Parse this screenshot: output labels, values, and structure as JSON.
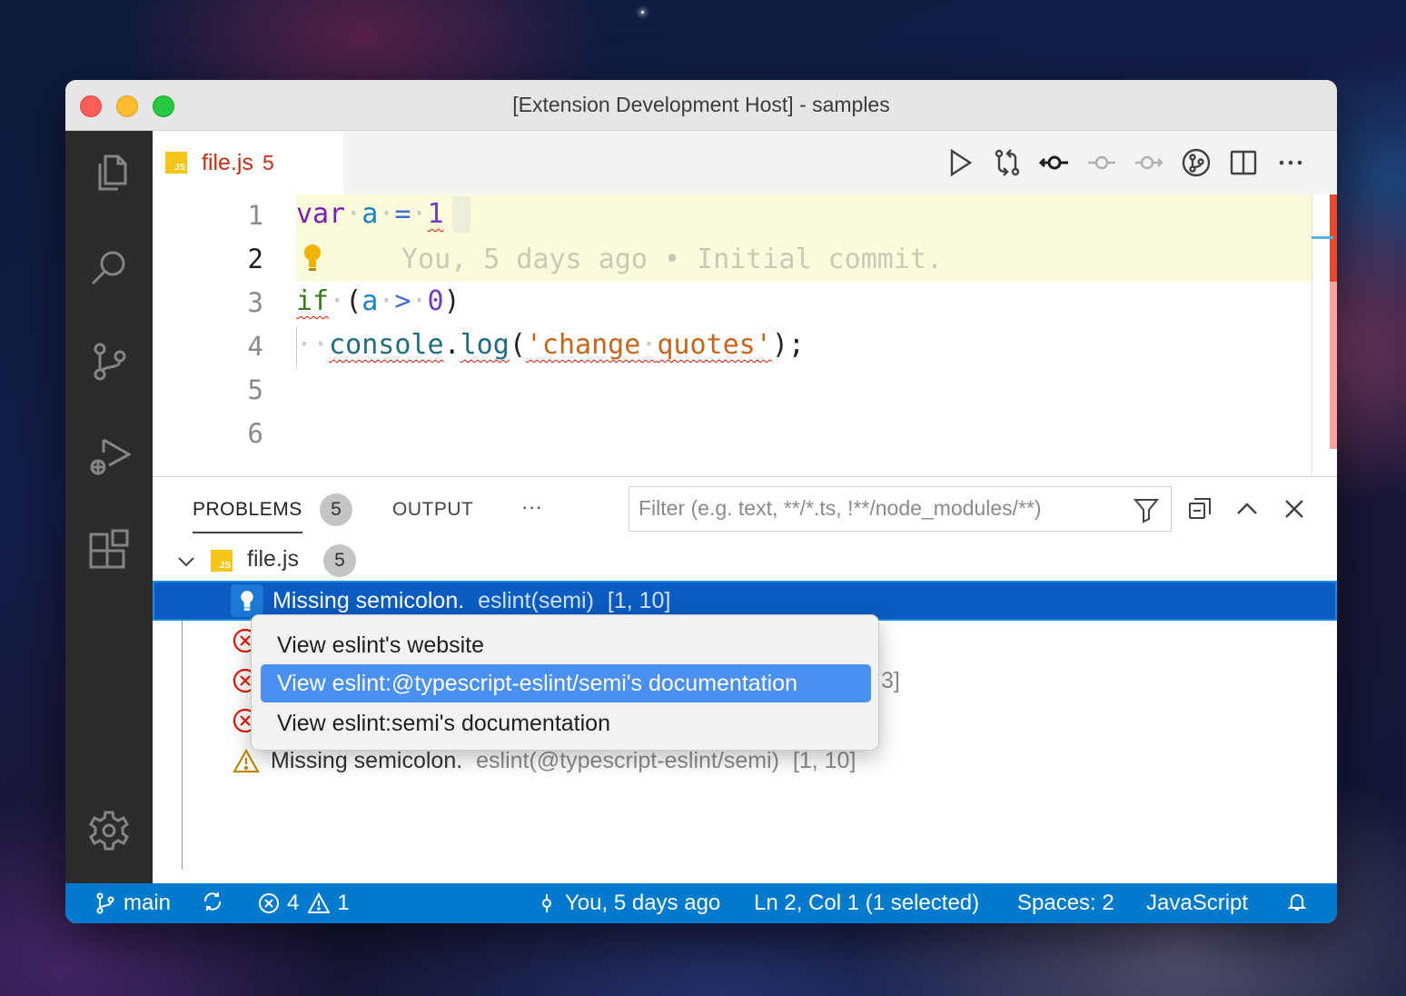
{
  "window": {
    "title": "[Extension Development Host] - samples"
  },
  "activity_bar": {
    "items": [
      {
        "name": "explorer",
        "icon": "files-icon"
      },
      {
        "name": "search",
        "icon": "search-icon"
      },
      {
        "name": "source-control",
        "icon": "source-control-icon"
      },
      {
        "name": "run-debug",
        "icon": "run-debug-icon"
      },
      {
        "name": "extensions",
        "icon": "extensions-icon"
      },
      {
        "name": "manage",
        "icon": "gear-icon"
      }
    ]
  },
  "tab": {
    "filename": "file.js",
    "problem_count": "5",
    "lang_badge": "JS"
  },
  "editor_actions": [
    "run-icon",
    "compare-changes-icon",
    "git-commit-icon",
    "previous-change-icon",
    "next-change-icon",
    "gitlens-icon",
    "split-editor-icon",
    "more-actions-icon"
  ],
  "editor": {
    "line_numbers": [
      "1",
      "2",
      "3",
      "4",
      "5",
      "6"
    ],
    "active_line": "2",
    "blame": "You, 5 days ago • Initial commit.",
    "lines": [
      "var a = 1",
      "",
      "if (a > 0)",
      "  console.log('change quotes');",
      "",
      ""
    ]
  },
  "panel": {
    "tabs": {
      "problems": "PROBLEMS",
      "problems_count": "5",
      "output": "OUTPUT",
      "more": "···"
    },
    "filter_placeholder": "Filter (e.g. text, **/*.ts, !**/node_modules/**)",
    "file": {
      "name": "file.js",
      "count": "5"
    },
    "problems": [
      {
        "severity": "info",
        "message": "Missing semicolon.",
        "source": "eslint(semi)",
        "location": "[1, 10]"
      },
      {
        "severity": "error",
        "message": "",
        "source": "",
        "location": ""
      },
      {
        "severity": "error",
        "message": "",
        "source": "",
        "location": "3]"
      },
      {
        "severity": "error",
        "message": "",
        "source": "",
        "location": ""
      },
      {
        "severity": "warning",
        "message": "Missing semicolon.",
        "source": "eslint(@typescript-eslint/semi)",
        "location": "[1, 10]"
      }
    ]
  },
  "context_menu": {
    "items": [
      "View eslint's website",
      "View eslint:@typescript-eslint/semi's documentation",
      "View eslint:semi's documentation"
    ],
    "active_index": 1
  },
  "status_bar": {
    "branch": "main",
    "errors": "4",
    "warnings": "1",
    "blame": "You, 5 days ago",
    "position": "Ln 2, Col 1 (1 selected)",
    "indent": "Spaces: 2",
    "language": "JavaScript"
  },
  "colors": {
    "activity_bar": "#2c2c2c",
    "status_bar": "#007acc",
    "selection": "#0a5cc2",
    "menu_highlight": "#4a90f0",
    "error": "#e51400",
    "warning": "#bf8803",
    "tab_dirty": "#c72e0f"
  }
}
